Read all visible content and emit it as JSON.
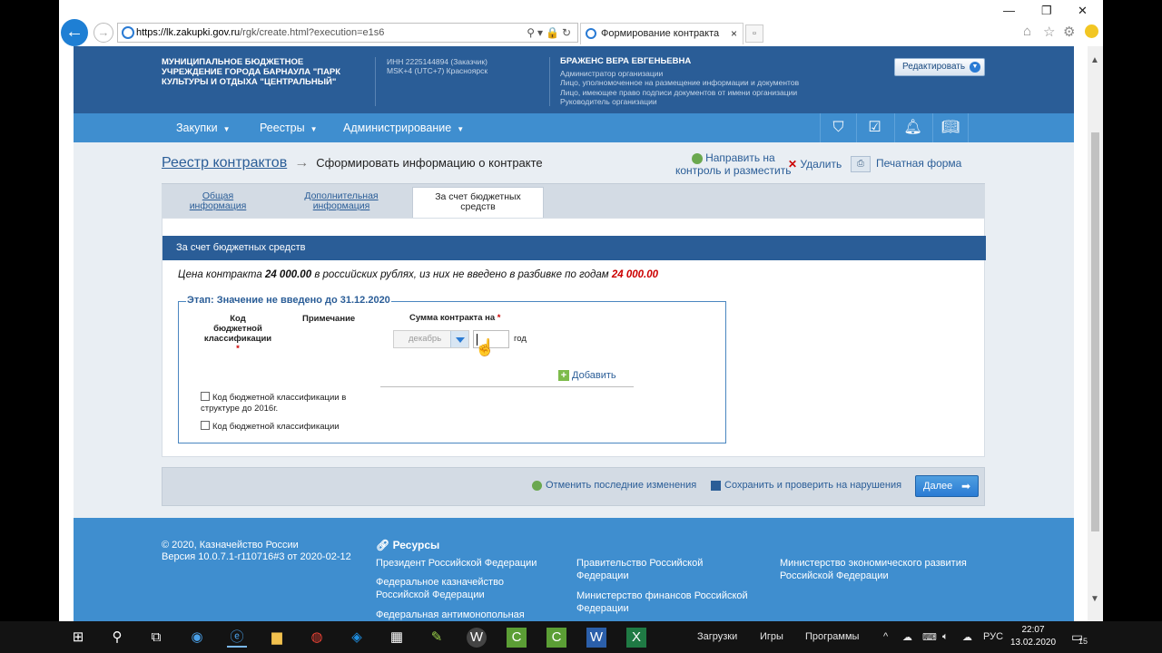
{
  "browser": {
    "url_host": "https://lk.zakupki.gov.ru",
    "url_path": "/rgk/create.html?execution=e1s6",
    "tab_title": "Формирование контракта",
    "tab_close": "×"
  },
  "header": {
    "org_name": "МУНИЦИПАЛЬНОЕ БЮДЖЕТНОЕ УЧРЕЖДЕНИЕ ГОРОДА БАРНАУЛА \"ПАРК КУЛЬТУРЫ И ОТДЫХА \"ЦЕНТРАЛЬНЫЙ\"",
    "inn": "ИНН 2225144894 (Заказчик)",
    "timezone": "MSK+4 (UTC+7) Красноярск",
    "user_name": "БРАЖЕНС ВЕРА ЕВГЕНЬЕВНА",
    "roles": [
      "Администратор организации",
      "Лицо, уполномоченное на размещение информации и документов",
      "Лицо, имеющее право подписи документов от имени организации",
      "Руководитель организации"
    ],
    "edit_button": "Редактировать"
  },
  "nav": {
    "items": [
      "Закупки",
      "Реестры",
      "Администрирование"
    ]
  },
  "breadcrumb": {
    "parent": "Реестр контрактов",
    "current": "Сформировать информацию о контракте"
  },
  "actions": {
    "send_line1": "Направить на",
    "send_line2": "контроль и разместить",
    "delete": "Удалить",
    "print": "Печатная форма"
  },
  "tabs": [
    {
      "line1": "Общая",
      "line2": "информация"
    },
    {
      "line1": "Дополнительная",
      "line2": "информация"
    },
    {
      "line1": "За счет бюджетных",
      "line2": "средств"
    }
  ],
  "section": {
    "title": "За счет бюджетных средств",
    "price_prefix": "Цена контракта",
    "price_value": "24 000.00",
    "price_middle": "в российских рублях, из них не введено в разбивке по годам",
    "price_unallocated": "24 000.00"
  },
  "stage": {
    "legend": "Этап: Значение не введено до 31.12.2020",
    "col_kbk_1": "Код",
    "col_kbk_2": "бюджетной",
    "col_kbk_3": "классификации",
    "col_note": "Примечание",
    "col_sum": "Сумма контракта на",
    "required_mark": "*",
    "month_select": "декабрь",
    "year_value": "",
    "year_label": "год",
    "add": "Добавить",
    "cb1_line1": "Код бюджетной классификации в",
    "cb1_line2": "структуре до 2016г.",
    "cb2": "Код бюджетной классификации"
  },
  "bottom": {
    "undo": "Отменить последние изменения",
    "save": "Сохранить и проверить на нарушения",
    "next": "Далее"
  },
  "footer": {
    "copyright": "© 2020, Казначейство России",
    "version": "Версия 10.0.7.1-r110716#3 от 2020-02-12",
    "resources": "Ресурсы",
    "links": [
      {
        "line1": "Президент Российской Федерации",
        "line2": ""
      },
      {
        "line1": "Федеральное казначейство",
        "line2": "Российской Федерации"
      },
      {
        "line1": "Федеральная антимонопольная",
        "line2": ""
      },
      {
        "line1": "Правительство Российской",
        "line2": "Федерации"
      },
      {
        "line1": "Министерство финансов Российской",
        "line2": "Федерации"
      },
      {
        "line1": "Министерство экономического развития",
        "line2": "Российской Федерации"
      }
    ]
  },
  "taskbar": {
    "downloads": "Загрузки",
    "games": "Игры",
    "programs": "Программы",
    "lang": "РУС",
    "time": "22:07",
    "date": "13.02.2020",
    "notifications": "15"
  }
}
